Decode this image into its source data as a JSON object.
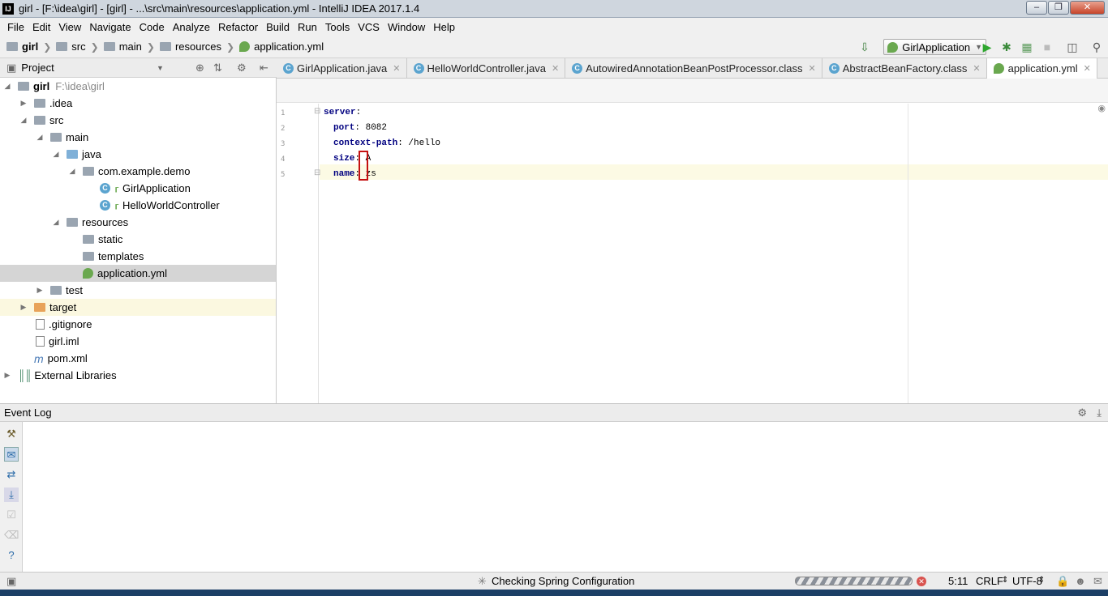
{
  "window": {
    "title": "girl - [F:\\idea\\girl] - [girl] - ...\\src\\main\\resources\\application.yml - IntelliJ IDEA 2017.1.4",
    "app_icon": "IJ"
  },
  "menu": [
    "File",
    "Edit",
    "View",
    "Navigate",
    "Code",
    "Analyze",
    "Refactor",
    "Build",
    "Run",
    "Tools",
    "VCS",
    "Window",
    "Help"
  ],
  "breadcrumb": [
    "girl",
    "src",
    "main",
    "resources",
    "application.yml"
  ],
  "toolbar": {
    "run_config": "GirlApplication"
  },
  "project_panel": {
    "title": "Project",
    "root_label": "girl",
    "root_path": "F:\\idea\\girl",
    "items": [
      {
        "label": ".idea",
        "icon": "folder-icon"
      },
      {
        "label": "src",
        "icon": "folder-icon"
      },
      {
        "label": "main",
        "icon": "folder-icon"
      },
      {
        "label": "java",
        "icon": "source-folder-icon"
      },
      {
        "label": "com.example.demo",
        "icon": "package-icon"
      },
      {
        "label": "GirlApplication",
        "icon": "spring-class-icon"
      },
      {
        "label": "HelloWorldController",
        "icon": "class-icon"
      },
      {
        "label": "resources",
        "icon": "resources-folder-icon"
      },
      {
        "label": "static",
        "icon": "folder-icon"
      },
      {
        "label": "templates",
        "icon": "folder-icon"
      },
      {
        "label": "application.yml",
        "icon": "spring-yml-icon"
      },
      {
        "label": "test",
        "icon": "folder-icon"
      },
      {
        "label": "target",
        "icon": "excluded-folder-icon"
      },
      {
        "label": ".gitignore",
        "icon": "text-file-icon"
      },
      {
        "label": "girl.iml",
        "icon": "iml-file-icon"
      },
      {
        "label": "pom.xml",
        "icon": "maven-icon"
      },
      {
        "label": "External Libraries",
        "icon": "libraries-icon"
      }
    ]
  },
  "tabs": [
    {
      "label": "GirlApplication.java"
    },
    {
      "label": "HelloWorldController.java"
    },
    {
      "label": "AutowiredAnnotationBeanPostProcessor.class"
    },
    {
      "label": "AbstractBeanFactory.class"
    },
    {
      "label": "application.yml"
    }
  ],
  "editor": {
    "lines": [
      {
        "num": "1",
        "key": "server",
        "sep": ":",
        "value": ""
      },
      {
        "num": "2",
        "key": "port",
        "sep": ": ",
        "value": "8082"
      },
      {
        "num": "3",
        "key": "context-path",
        "sep": ": ",
        "value": "/hello"
      },
      {
        "num": "4",
        "key": "size",
        "sep": ": ",
        "value": "A"
      },
      {
        "num": "5",
        "key": "name",
        "sep": ": ",
        "value": "zs"
      }
    ]
  },
  "event_log": {
    "title": "Event Log"
  },
  "status": {
    "message": "Checking Spring Configuration",
    "position": "5:11",
    "line_sep": "CRLF",
    "encoding": "UTF-8"
  }
}
